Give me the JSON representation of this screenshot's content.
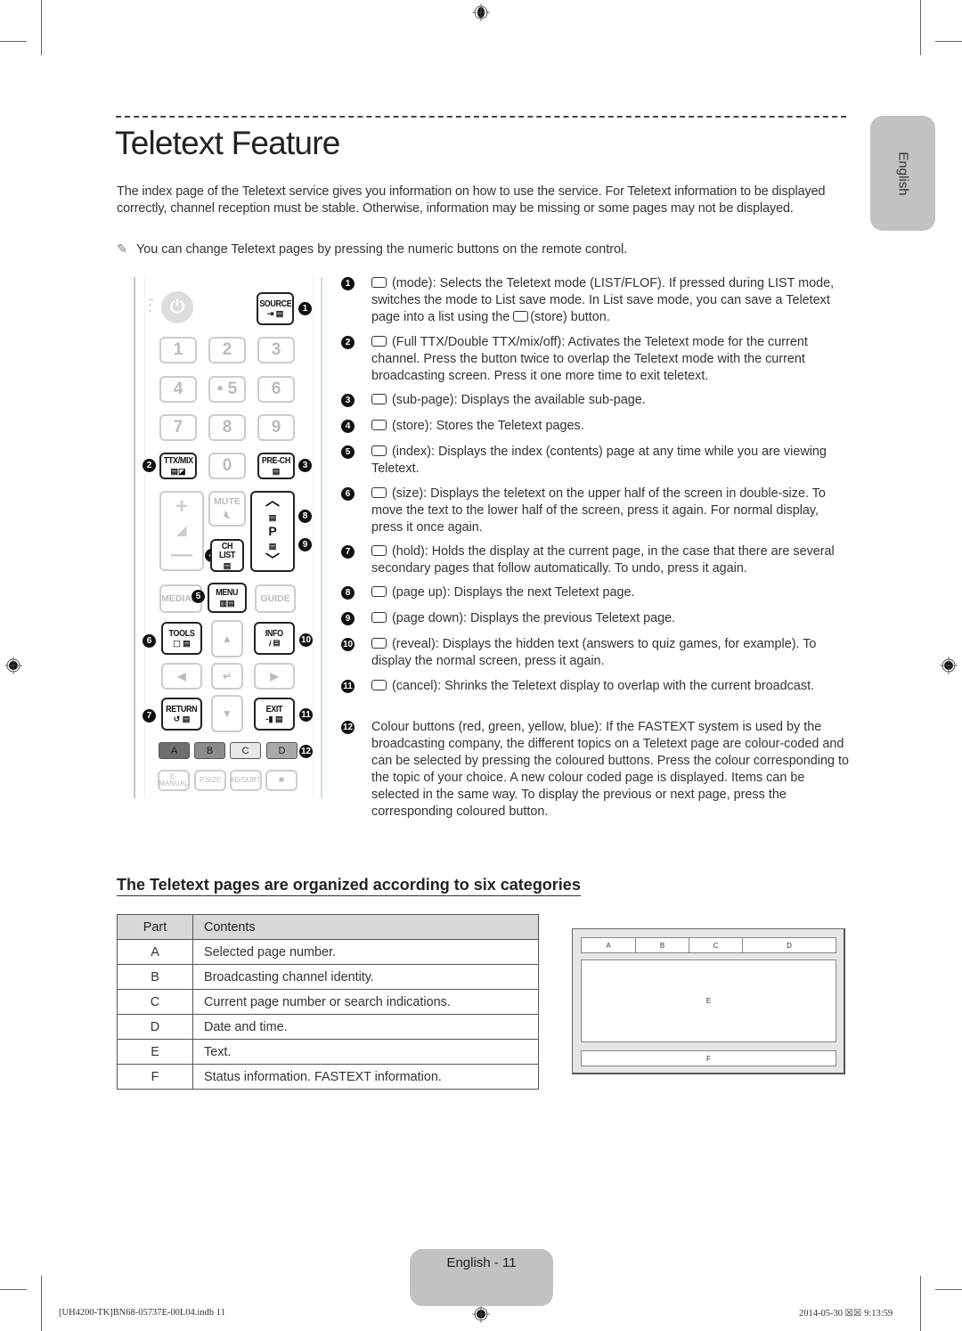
{
  "page": {
    "title": "Teletext Feature",
    "language_tab": "English",
    "intro": "The index page of the Teletext service gives you information on how to use the service. For Teletext information to be displayed correctly, channel reception must be stable. Otherwise, information may be missing or some pages may not be displayed.",
    "note_icon": "pencil-note-icon",
    "note_symbol": "✎",
    "note": "You can change Teletext pages by pressing the numeric buttons on the remote control."
  },
  "remote": {
    "source": "SOURCE",
    "numbers": [
      "1",
      "2",
      "3",
      "4",
      "• 5",
      "6",
      "7",
      "8",
      "9",
      "0"
    ],
    "ttx_mix": "TTX/MIX",
    "pre_ch": "PRE-CH",
    "mute": "MUTE",
    "ch_list": "CH LIST",
    "p": "P",
    "media": "MEDIA.P",
    "menu": "MENU",
    "guide": "GUIDE",
    "tools": "TOOLS",
    "info": "INFO",
    "return": "RETURN",
    "exit": "EXIT",
    "colour_buttons": [
      {
        "label": "A",
        "color": "#6d6e70"
      },
      {
        "label": "B",
        "color": "#8a8b8d"
      },
      {
        "label": "C",
        "color": "#e6e7e8"
      },
      {
        "label": "D",
        "color": "#a7a9ac"
      }
    ],
    "bottom": [
      "E-MANUAL",
      "P.SIZE",
      "AD/SUBT.",
      "■"
    ],
    "callouts": [
      "1",
      "2",
      "3",
      "4",
      "5",
      "6",
      "7",
      "8",
      "9",
      "10",
      "11",
      "12"
    ]
  },
  "descriptions": [
    {
      "n": "1",
      "icon": "mode-icon",
      "text": "(mode): Selects the Teletext mode (LIST/FLOF). If pressed during LIST mode, switches the mode to List save mode. In List save mode, you can save a Teletext page into a list using the",
      "tail": "(store) button."
    },
    {
      "n": "2",
      "icon": "full-ttx-icon",
      "text": "(Full TTX/Double TTX/mix/off): Activates the Teletext mode for the current channel. Press the button twice to overlap the Teletext mode with the current broadcasting screen. Press it one more time to exit teletext."
    },
    {
      "n": "3",
      "icon": "sub-page-icon",
      "text": "(sub-page): Displays the available sub-page."
    },
    {
      "n": "4",
      "icon": "store-icon",
      "text": "(store): Stores the Teletext pages."
    },
    {
      "n": "5",
      "icon": "index-icon",
      "text": "(index): Displays the index (contents) page at any time while you are viewing Teletext."
    },
    {
      "n": "6",
      "icon": "size-icon",
      "text": "(size): Displays the teletext on the upper half of the screen in double-size. To move the text to the lower half of the screen, press it again. For normal display, press it once again."
    },
    {
      "n": "7",
      "icon": "hold-icon",
      "text": "(hold): Holds the display at the current page, in the case that there are several secondary pages that follow automatically. To undo, press it again."
    },
    {
      "n": "8",
      "icon": "page-up-icon",
      "text": "(page up): Displays the next Teletext page."
    },
    {
      "n": "9",
      "icon": "page-down-icon",
      "text": "(page down): Displays the previous Teletext page."
    },
    {
      "n": "10",
      "icon": "reveal-icon",
      "text": "(reveal): Displays the hidden text (answers to quiz games, for example). To display the normal screen, press it again."
    },
    {
      "n": "11",
      "icon": "cancel-icon",
      "text": "(cancel): Shrinks the Teletext display to overlap with the current broadcast."
    },
    {
      "n": "12",
      "icon": "",
      "text": "Colour buttons (red, green, yellow, blue): If the FASTEXT system is used by the broadcasting company, the different topics on a Teletext page are colour-coded and can be selected by pressing the coloured buttons. Press the colour corresponding to the topic of your choice. A new colour coded page is displayed. Items can be selected in the same way. To display the previous or next page, press the corresponding coloured button."
    }
  ],
  "categories": {
    "title": "The Teletext pages are organized according to six categories",
    "headers": [
      "Part",
      "Contents"
    ],
    "rows": [
      [
        "A",
        "Selected page number."
      ],
      [
        "B",
        "Broadcasting channel identity."
      ],
      [
        "C",
        "Current page number or search indications."
      ],
      [
        "D",
        "Date and time."
      ],
      [
        "E",
        "Text."
      ],
      [
        "F",
        "Status information. FASTEXT information."
      ]
    ]
  },
  "diagram": {
    "top": [
      "A",
      "B",
      "C",
      "D"
    ],
    "middle": "E",
    "bottom": "F"
  },
  "footer": {
    "page_label": "English - 11",
    "slug_left": "[UH4200-TK]BN68-05737E-00L04.indb   11",
    "slug_right": "2014-05-30   ☒☒ 9:13:59"
  }
}
